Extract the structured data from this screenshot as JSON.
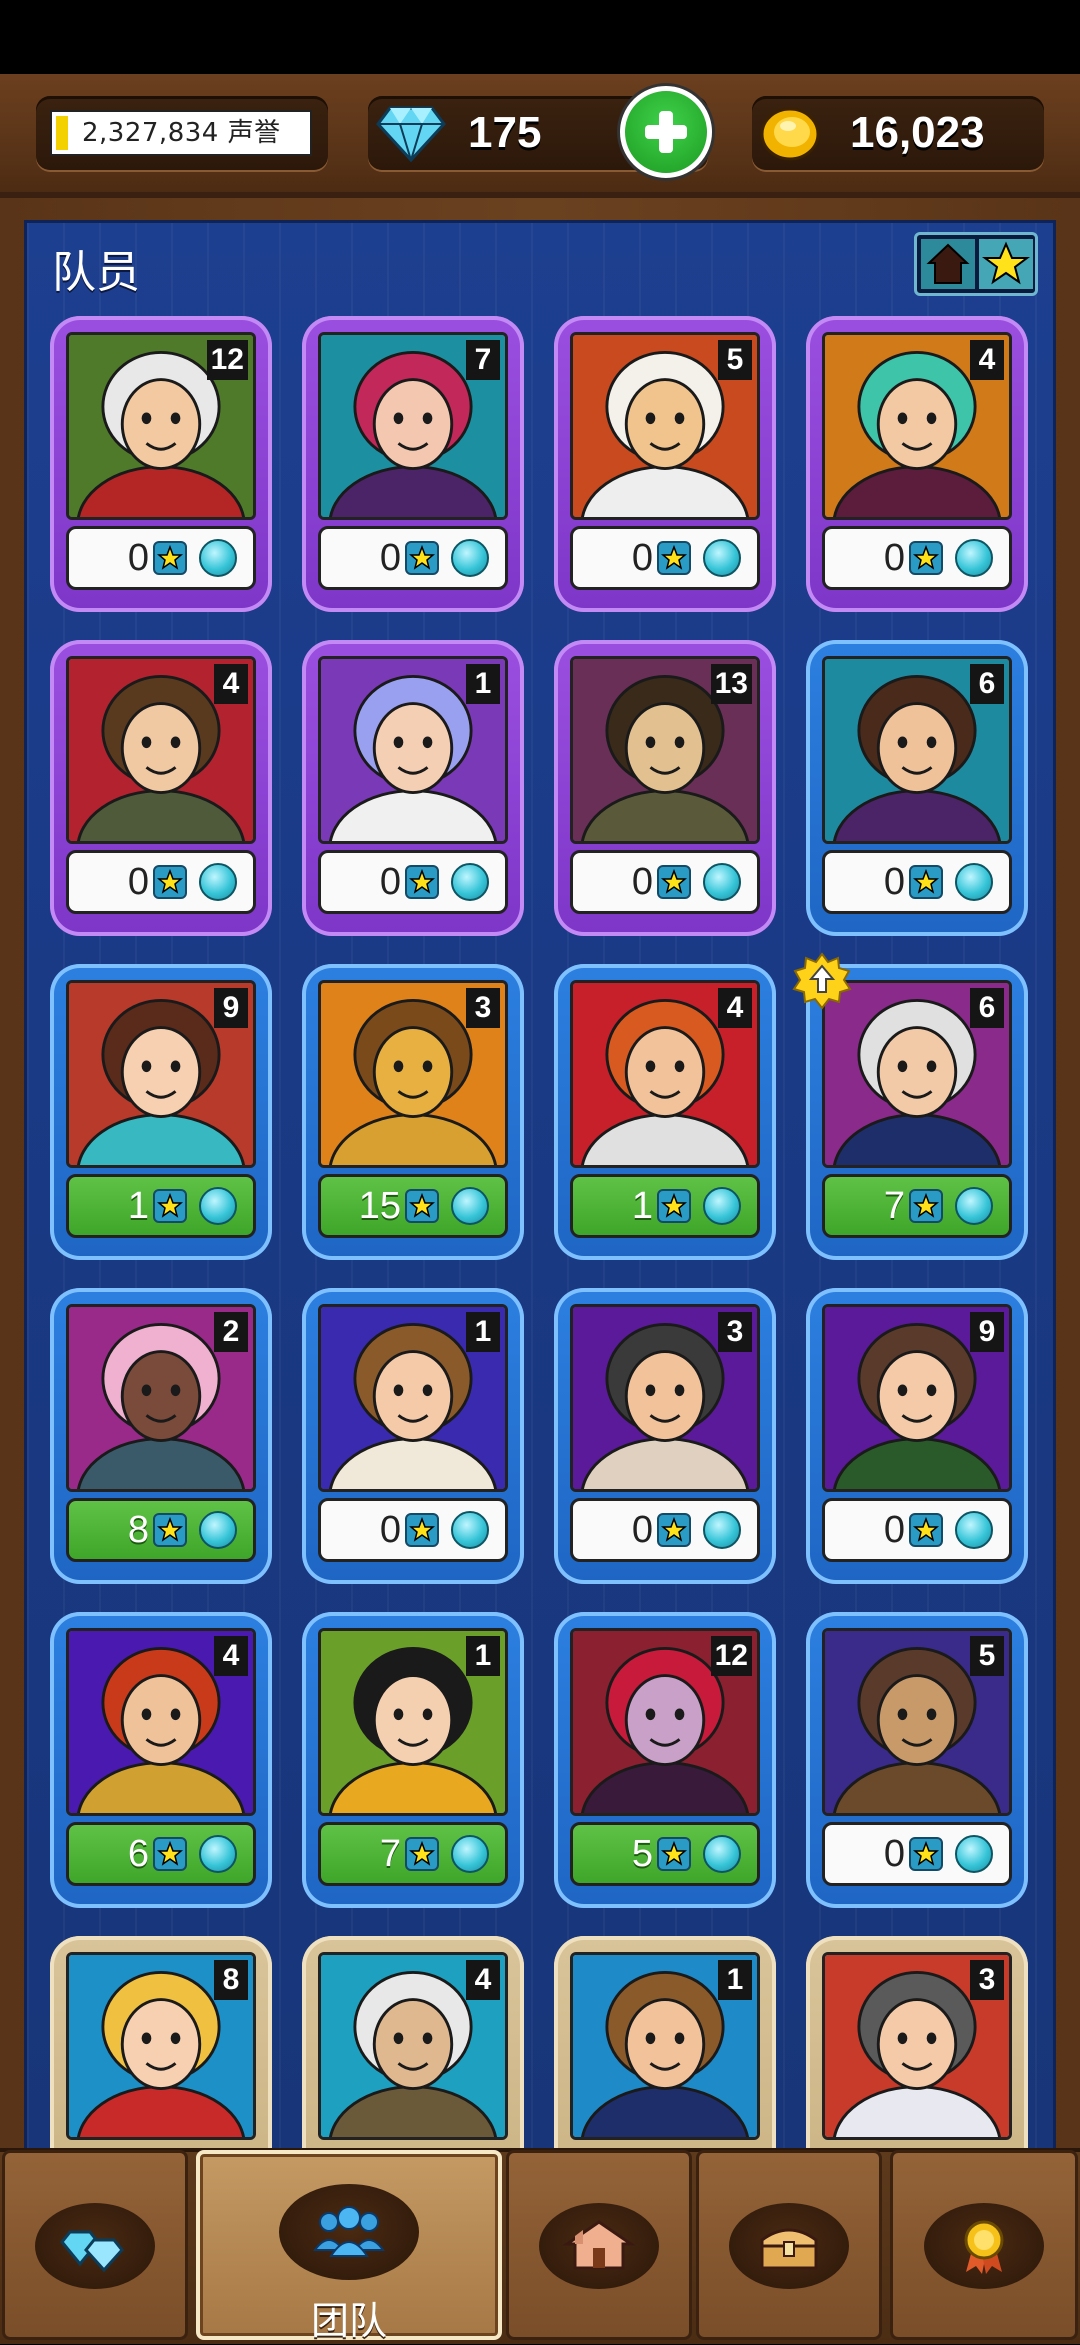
{
  "resources": {
    "reputation": "2,327,834 声誉",
    "reputation_fill": 0.03,
    "gems": "175",
    "gold": "16,023"
  },
  "panel": {
    "title": "队员",
    "sort_icons": [
      "home-icon",
      "star-icon"
    ]
  },
  "crew": [
    {
      "level": "12",
      "stars": "0",
      "rarity": "purple",
      "upgraded": false,
      "bg": "#4f7a2a",
      "skin": "#f2c9a0",
      "hair": "#e8e8e8",
      "outfit": "#b42626"
    },
    {
      "level": "7",
      "stars": "0",
      "rarity": "purple",
      "upgraded": false,
      "bg": "#1c8fa1",
      "skin": "#f4c8b0",
      "hair": "#c2285a",
      "outfit": "#4a2466"
    },
    {
      "level": "5",
      "stars": "0",
      "rarity": "purple",
      "upgraded": false,
      "bg": "#c84a1e",
      "skin": "#f0c48c",
      "hair": "#f4f0ea",
      "outfit": "#eeeeee"
    },
    {
      "level": "4",
      "stars": "0",
      "rarity": "purple",
      "upgraded": false,
      "bg": "#d07a1a",
      "skin": "#f3c9a4",
      "hair": "#3ec4a8",
      "outfit": "#5c1c3c"
    },
    {
      "level": "4",
      "stars": "0",
      "rarity": "purple",
      "upgraded": false,
      "bg": "#b3232f",
      "skin": "#f0c8a2",
      "hair": "#5a3a1e",
      "outfit": "#4f5a3a"
    },
    {
      "level": "1",
      "stars": "0",
      "rarity": "purple",
      "upgraded": false,
      "bg": "#7a3ab8",
      "skin": "#f5cfb4",
      "hair": "#9aa0f0",
      "outfit": "#f0f0f0"
    },
    {
      "level": "13",
      "stars": "0",
      "rarity": "purple",
      "upgraded": false,
      "bg": "#6a2f56",
      "skin": "#e2c090",
      "hair": "#3a2a1a",
      "outfit": "#5a5a3a"
    },
    {
      "level": "6",
      "stars": "0",
      "rarity": "blue",
      "upgraded": false,
      "bg": "#1e8aa0",
      "skin": "#f0c29a",
      "hair": "#4a2a1a",
      "outfit": "#4a2466"
    },
    {
      "level": "9",
      "stars": "1",
      "rarity": "blue",
      "upgraded": false,
      "bg": "#b83a2a",
      "skin": "#f6d0b0",
      "hair": "#5a2a1a",
      "outfit": "#38b8c0"
    },
    {
      "level": "3",
      "stars": "15",
      "rarity": "blue",
      "upgraded": false,
      "bg": "#e0821a",
      "skin": "#e8b040",
      "hair": "#7a4a1a",
      "outfit": "#d8a030"
    },
    {
      "level": "4",
      "stars": "1",
      "rarity": "blue",
      "upgraded": false,
      "bg": "#c8202a",
      "skin": "#f2c29a",
      "hair": "#d85a20",
      "outfit": "#e0e0e0"
    },
    {
      "level": "6",
      "stars": "7",
      "rarity": "blue",
      "upgraded": true,
      "bg": "#8a2a8a",
      "skin": "#f2caa8",
      "hair": "#e0e0e0",
      "outfit": "#1e2e6a"
    },
    {
      "level": "2",
      "stars": "8",
      "rarity": "blue",
      "upgraded": false,
      "bg": "#9a2a8a",
      "skin": "#7a4a3a",
      "hair": "#f0b0d0",
      "outfit": "#3a5a6a"
    },
    {
      "level": "1",
      "stars": "0",
      "rarity": "blue",
      "upgraded": false,
      "bg": "#3a2ab0",
      "skin": "#f4caa8",
      "hair": "#8a5a2a",
      "outfit": "#f0e8d8"
    },
    {
      "level": "3",
      "stars": "0",
      "rarity": "blue",
      "upgraded": false,
      "bg": "#5a1a9a",
      "skin": "#f2c29a",
      "hair": "#3a3a3a",
      "outfit": "#e0d0c0"
    },
    {
      "level": "9",
      "stars": "0",
      "rarity": "blue",
      "upgraded": false,
      "bg": "#5a1a9a",
      "skin": "#f4caa8",
      "hair": "#5a3a2a",
      "outfit": "#2a5a2a"
    },
    {
      "level": "4",
      "stars": "6",
      "rarity": "blue",
      "upgraded": false,
      "bg": "#4a1ab0",
      "skin": "#f0c29a",
      "hair": "#c83a1a",
      "outfit": "#d0a030"
    },
    {
      "level": "1",
      "stars": "7",
      "rarity": "blue",
      "upgraded": false,
      "bg": "#6aa02a",
      "skin": "#f4d0b0",
      "hair": "#1a1a1a",
      "outfit": "#e8a820"
    },
    {
      "level": "12",
      "stars": "5",
      "rarity": "blue",
      "upgraded": false,
      "bg": "#8a2030",
      "skin": "#c8a0c8",
      "hair": "#c81a3a",
      "outfit": "#3a1a3a"
    },
    {
      "level": "5",
      "stars": "0",
      "rarity": "blue",
      "upgraded": false,
      "bg": "#3a2a8a",
      "skin": "#c89a6a",
      "hair": "#5a3a2a",
      "outfit": "#6a4a2a"
    },
    {
      "level": "8",
      "stars": "",
      "rarity": "tan",
      "upgraded": false,
      "bg": "#1e90c8",
      "skin": "#f6d0b0",
      "hair": "#f0c040",
      "outfit": "#c82a2a"
    },
    {
      "level": "4",
      "stars": "",
      "rarity": "tan",
      "upgraded": false,
      "bg": "#1ea0c0",
      "skin": "#e0b890",
      "hair": "#e8e8e8",
      "outfit": "#6a5a3a"
    },
    {
      "level": "1",
      "stars": "",
      "rarity": "tan",
      "upgraded": false,
      "bg": "#1e8ac8",
      "skin": "#f2c29a",
      "hair": "#8a5a2a",
      "outfit": "#1e2e6a"
    },
    {
      "level": "3",
      "stars": "",
      "rarity": "tan",
      "upgraded": false,
      "bg": "#c83a2a",
      "skin": "#f4caa8",
      "hair": "#5a5a5a",
      "outfit": "#e8e8f0"
    }
  ],
  "nav": {
    "tabs": [
      {
        "icon": "gems-icon",
        "label": ""
      },
      {
        "icon": "team-icon",
        "label": "团队"
      },
      {
        "icon": "buildings-icon",
        "label": ""
      },
      {
        "icon": "chest-icon",
        "label": ""
      },
      {
        "icon": "medal-icon",
        "label": ""
      }
    ],
    "active": 1
  },
  "colors": {
    "purple_card": "#8a44d6",
    "blue_card": "#2573d2",
    "tan_card": "#d4bd8f",
    "green_bar": "#4fb438",
    "panel_bg": "#1c3c8a",
    "wood": "#5e3a1c"
  }
}
